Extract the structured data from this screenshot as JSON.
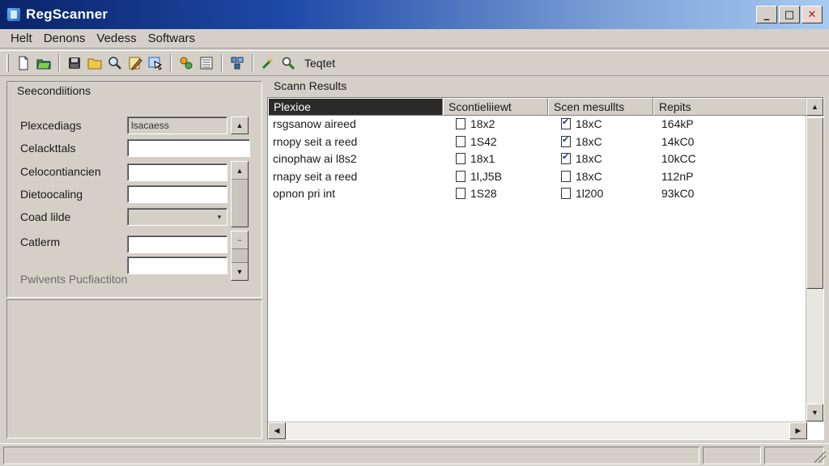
{
  "window": {
    "title": "RegScanner"
  },
  "menu": [
    "Helt",
    "Denons",
    "Vedess",
    "Softwars"
  ],
  "toolbar": {
    "label": "Teqtet"
  },
  "conditions": {
    "title": "Seecondiitions",
    "fields": [
      {
        "label": "Plexcediags",
        "value": "lsacaess"
      },
      {
        "label": "Celackttals",
        "value": ""
      },
      {
        "label": "Celocontiancien",
        "value": ""
      },
      {
        "label": "Dietoocaling",
        "value": ""
      },
      {
        "label": "Coad lilde",
        "value": ""
      },
      {
        "label": "Catlerm",
        "value": ""
      }
    ],
    "footer": "Pwivents Pucfiactiton"
  },
  "results": {
    "title": "Scann Results",
    "columns": [
      "Plexioe",
      "Scontieliiewt",
      "Scen mesullts",
      "Repits"
    ],
    "rows": [
      {
        "name": "rsgsanow aireed",
        "col2": "18x2",
        "col3": "18xC",
        "col4": "164kP"
      },
      {
        "name": "rnopy seit a reed",
        "col2": "1S42",
        "col3": "18xC",
        "col4": "14kC0"
      },
      {
        "name": "cinophaw ai l8s2",
        "col2": "18x1",
        "col3": "18xC",
        "col4": "10kCC"
      },
      {
        "name": "rnapy seit a reed",
        "col2": "1l,J5B",
        "col3": "18xC",
        "col4": "112nP"
      },
      {
        "name": "opnon pri int",
        "col2": "1S28",
        "col3": "1l200",
        "col4": "93kC0"
      }
    ],
    "row_checked_col3": [
      true,
      true,
      true,
      false,
      false
    ]
  }
}
